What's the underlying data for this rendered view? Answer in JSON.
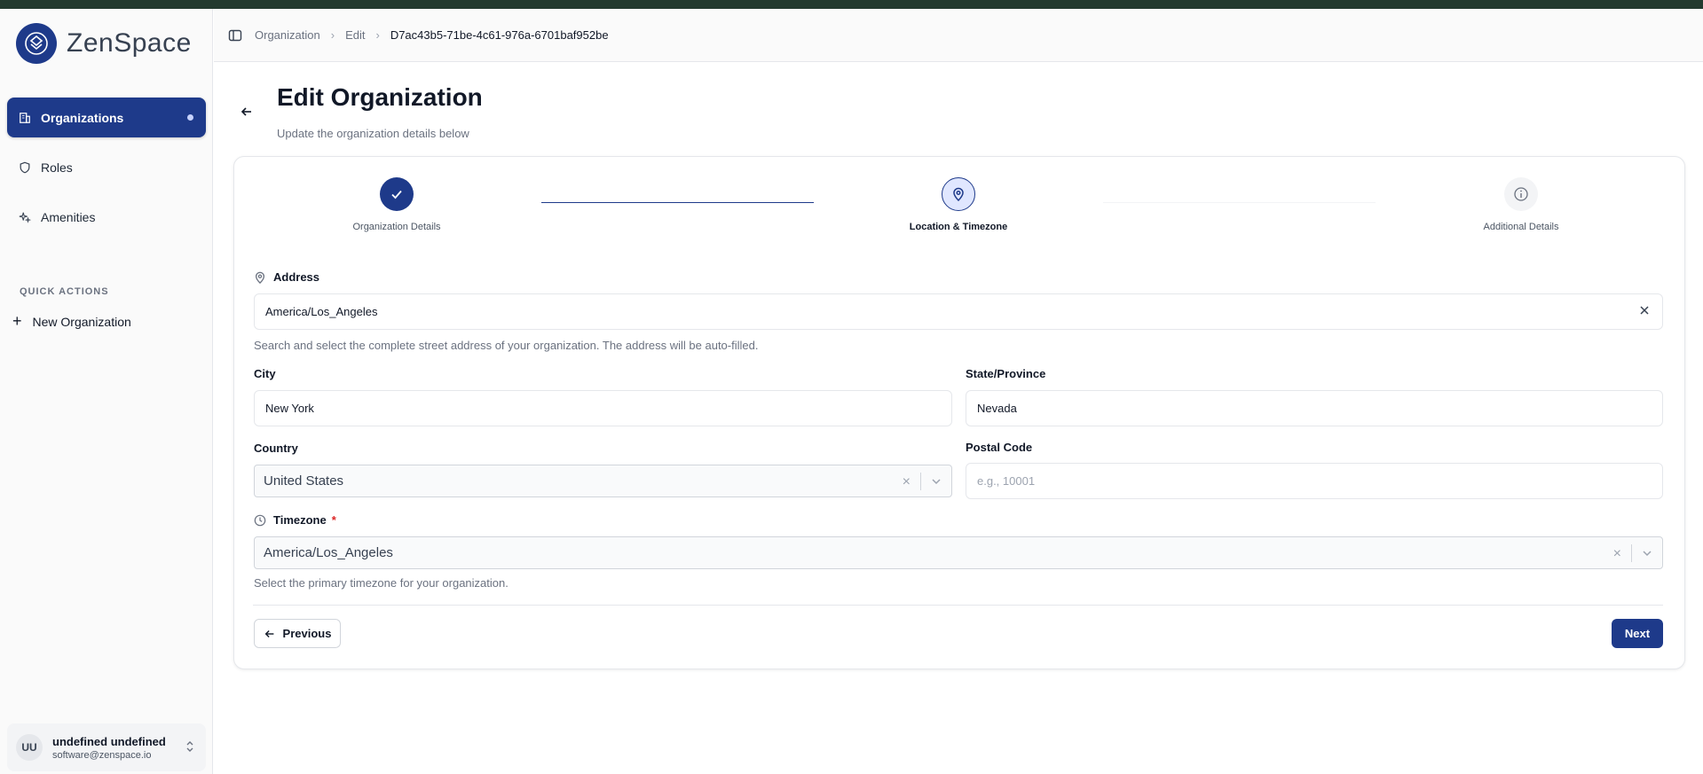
{
  "brand": {
    "name": "ZenSpace"
  },
  "sidebar": {
    "items": [
      {
        "label": "Organizations",
        "icon": "building-icon",
        "active": true
      },
      {
        "label": "Roles",
        "icon": "shield-icon",
        "active": false
      },
      {
        "label": "Amenities",
        "icon": "sparkles-icon",
        "active": false
      }
    ],
    "quick_actions_title": "QUICK ACTIONS",
    "quick_actions": [
      {
        "label": "New Organization",
        "icon": "plus-icon"
      }
    ],
    "user": {
      "initials": "UU",
      "name": "undefined undefined",
      "email": "software@zenspace.io"
    }
  },
  "breadcrumb": {
    "items": [
      "Organization",
      "Edit",
      "D7ac43b5-71be-4c61-976a-6701baf952be"
    ]
  },
  "page": {
    "title": "Edit Organization",
    "subtitle": "Update the organization details below"
  },
  "stepper": {
    "steps": [
      {
        "label": "Organization Details",
        "state": "done"
      },
      {
        "label": "Location & Timezone",
        "state": "current"
      },
      {
        "label": "Additional Details",
        "state": "todo"
      }
    ]
  },
  "form": {
    "address": {
      "label": "Address",
      "value": "America/Los_Angeles",
      "hint": "Search and select the complete street address of your organization. The address will be auto-filled."
    },
    "city": {
      "label": "City",
      "value": "New York"
    },
    "state": {
      "label": "State/Province",
      "value": "Nevada"
    },
    "country": {
      "label": "Country",
      "value": "United States"
    },
    "postal": {
      "label": "Postal Code",
      "value": "",
      "placeholder": "e.g., 10001"
    },
    "timezone": {
      "label": "Timezone",
      "required_mark": "*",
      "value": "America/Los_Angeles",
      "hint": "Select the primary timezone for your organization."
    }
  },
  "actions": {
    "previous": "Previous",
    "next": "Next"
  },
  "colors": {
    "primary": "#1e3a8a",
    "topbar": "#233a2f",
    "required": "#dc2626"
  }
}
